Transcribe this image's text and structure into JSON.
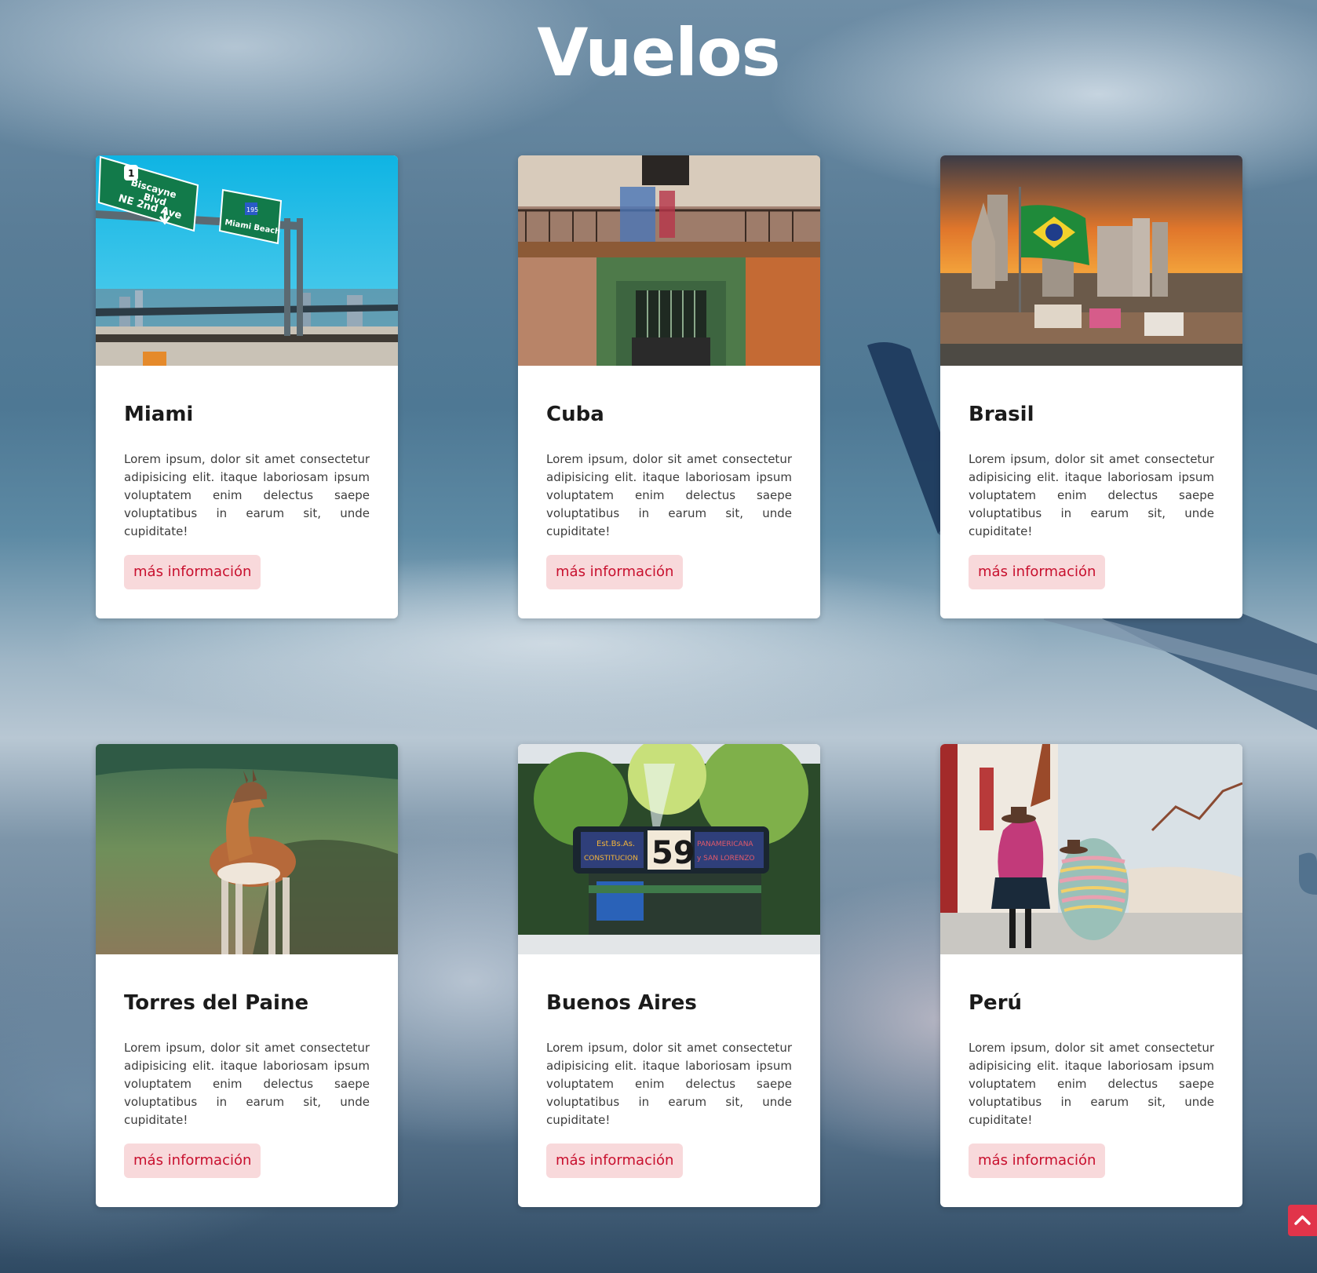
{
  "page": {
    "title": "Vuelos"
  },
  "colors": {
    "button_bg": "#f8d9db",
    "button_text": "#c8102e",
    "scroll_top_bg": "#e1344a"
  },
  "cards": [
    {
      "title": "Miami",
      "text": "Lorem ipsum, dolor sit amet consectetur adipisicing elit. itaque laboriosam ipsum voluptatem enim delectus saepe voluptatibus in earum sit, unde cupiditate!",
      "button": "más información"
    },
    {
      "title": "Cuba",
      "text": "Lorem ipsum, dolor sit amet consectetur adipisicing elit. itaque laboriosam ipsum voluptatem enim delectus saepe voluptatibus in earum sit, unde cupiditate!",
      "button": "más información"
    },
    {
      "title": "Brasil",
      "text": "Lorem ipsum, dolor sit amet consectetur adipisicing elit. itaque laboriosam ipsum voluptatem enim delectus saepe voluptatibus in earum sit, unde cupiditate!",
      "button": "más información"
    },
    {
      "title": "Torres del Paine",
      "text": "Lorem ipsum, dolor sit amet consectetur adipisicing elit. itaque laboriosam ipsum voluptatem enim delectus saepe voluptatibus in earum sit, unde cupiditate!",
      "button": "más información"
    },
    {
      "title": "Buenos Aires",
      "text": "Lorem ipsum, dolor sit amet consectetur adipisicing elit. itaque laboriosam ipsum voluptatem enim delectus saepe voluptatibus in earum sit, unde cupiditate!",
      "button": "más información"
    },
    {
      "title": "Perú",
      "text": "Lorem ipsum, dolor sit amet consectetur adipisicing elit. itaque laboriosam ipsum voluptatem enim delectus saepe voluptatibus in earum sit, unde cupiditate!",
      "button": "más información"
    }
  ],
  "photos": {
    "miami_sign_lines": [
      "1",
      "Biscayne",
      "Blvd",
      "NE 2nd Ave",
      "195",
      "Miami Beach"
    ],
    "buenos_aires_bus": {
      "number": "59",
      "left_sign": [
        "Est.Bs.As.",
        "CONSTITUCION"
      ],
      "right_sign": [
        "PANAMERICANA",
        "y SAN LORENZO"
      ]
    }
  },
  "scroll_top": {
    "icon": "chevron-up-icon"
  }
}
